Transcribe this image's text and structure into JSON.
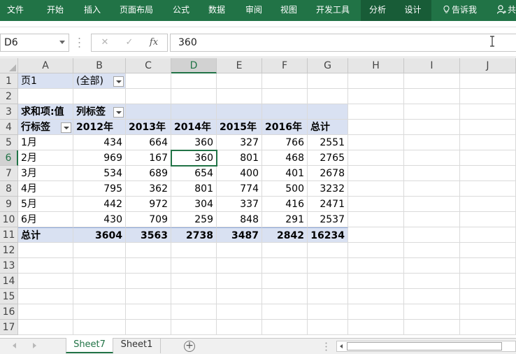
{
  "ribbon": {
    "tabs": [
      "文件",
      "开始",
      "插入",
      "页面布局",
      "公式",
      "数据",
      "审阅",
      "视图",
      "开发工具"
    ],
    "context_tabs": [
      "分析",
      "设计"
    ],
    "tell_me": "告诉我",
    "share": "共"
  },
  "formula_bar": {
    "name_box": "D6",
    "cancel_icon": "✕",
    "enter_icon": "✓",
    "fx_label": "fx",
    "content": "360"
  },
  "grid": {
    "columns": [
      "A",
      "B",
      "C",
      "D",
      "E",
      "F",
      "G",
      "H",
      "I",
      "J"
    ],
    "rows": [
      "1",
      "2",
      "3",
      "4",
      "5",
      "6",
      "7",
      "8",
      "9",
      "10",
      "11",
      "12",
      "13",
      "14",
      "15",
      "16",
      "17"
    ],
    "active_cell": "D6"
  },
  "pivot": {
    "filter_label": "页1",
    "filter_value": "(全部)",
    "values_label": "求和项:值",
    "col_labels": "列标签",
    "row_labels": "行标签",
    "years": [
      "2012年",
      "2013年",
      "2014年",
      "2015年",
      "2016年"
    ],
    "grand_total_label": "总计",
    "rows": [
      {
        "label": "1月",
        "values": [
          "434",
          "664",
          "360",
          "327",
          "766"
        ],
        "total": "2551"
      },
      {
        "label": "2月",
        "values": [
          "969",
          "167",
          "360",
          "801",
          "468"
        ],
        "total": "2765"
      },
      {
        "label": "3月",
        "values": [
          "534",
          "689",
          "654",
          "400",
          "401"
        ],
        "total": "2678"
      },
      {
        "label": "4月",
        "values": [
          "795",
          "362",
          "801",
          "774",
          "500"
        ],
        "total": "3232"
      },
      {
        "label": "5月",
        "values": [
          "442",
          "972",
          "304",
          "337",
          "416"
        ],
        "total": "2471"
      },
      {
        "label": "6月",
        "values": [
          "430",
          "709",
          "259",
          "848",
          "291"
        ],
        "total": "2537"
      }
    ],
    "totals": {
      "label": "总计",
      "values": [
        "3604",
        "3563",
        "2738",
        "3487",
        "2842"
      ],
      "total": "16234"
    }
  },
  "sheets": {
    "tabs": [
      "Sheet7",
      "Sheet1"
    ],
    "active": "Sheet7",
    "add_icon": "+"
  },
  "colors": {
    "ribbon": "#217346",
    "context_tab": "#185c37",
    "pivot_highlight": "#d9e1f2",
    "selection": "#217346"
  }
}
